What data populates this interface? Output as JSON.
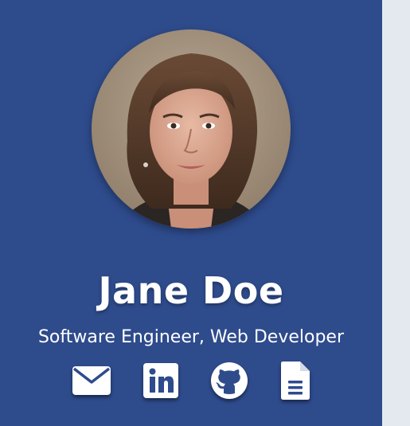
{
  "profile": {
    "name": "Jane Doe",
    "subtitle": "Software Engineer, Web Developer",
    "avatar_alt": "Profile photo"
  },
  "social_links": [
    {
      "icon": "envelope-icon"
    },
    {
      "icon": "linkedin-icon"
    },
    {
      "icon": "github-icon"
    },
    {
      "icon": "document-icon"
    }
  ],
  "colors": {
    "sidebar_bg": "#2e4b8c",
    "text": "#ffffff",
    "page_bg": "#e3e8ef"
  }
}
